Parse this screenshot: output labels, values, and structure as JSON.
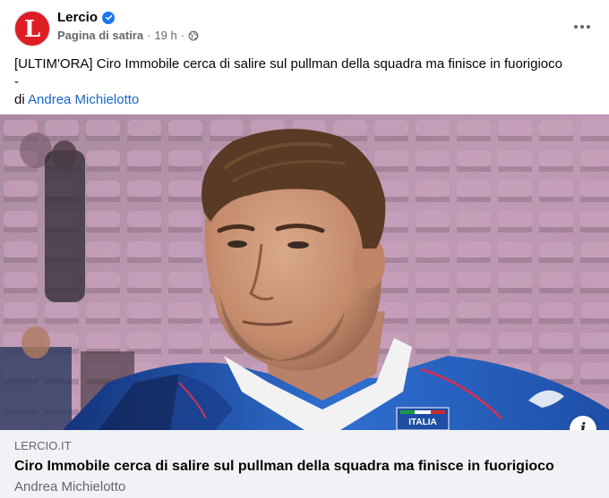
{
  "post": {
    "page_name": "Lercio",
    "avatar_letter": "L",
    "category": "Pagina di satira",
    "time": "19 h",
    "separator": "·",
    "text_line1": "[ULTIM'ORA] Ciro Immobile cerca di salire sul pullman della squadra ma finisce in fuorigioco",
    "text_line2": "-",
    "text_by": "di ",
    "author_link": "Andrea Michielotto"
  },
  "image": {
    "jersey_badge": "ITALIA"
  },
  "link_preview": {
    "domain": "LERCIO.IT",
    "title": "Ciro Immobile cerca di salire sul pullman della squadra ma finisce in fuorigioco",
    "author": "Andrea Michielotto",
    "info_label": "i"
  },
  "colors": {
    "brand_red": "#e01c24",
    "verified_blue": "#1877f2",
    "link_blue": "#1b66c9",
    "card_bg": "#f0f2f5"
  },
  "icons": {
    "verified": "verified-badge-icon",
    "audience": "globe-icon",
    "more": "more-options-icon",
    "info": "info-icon"
  }
}
